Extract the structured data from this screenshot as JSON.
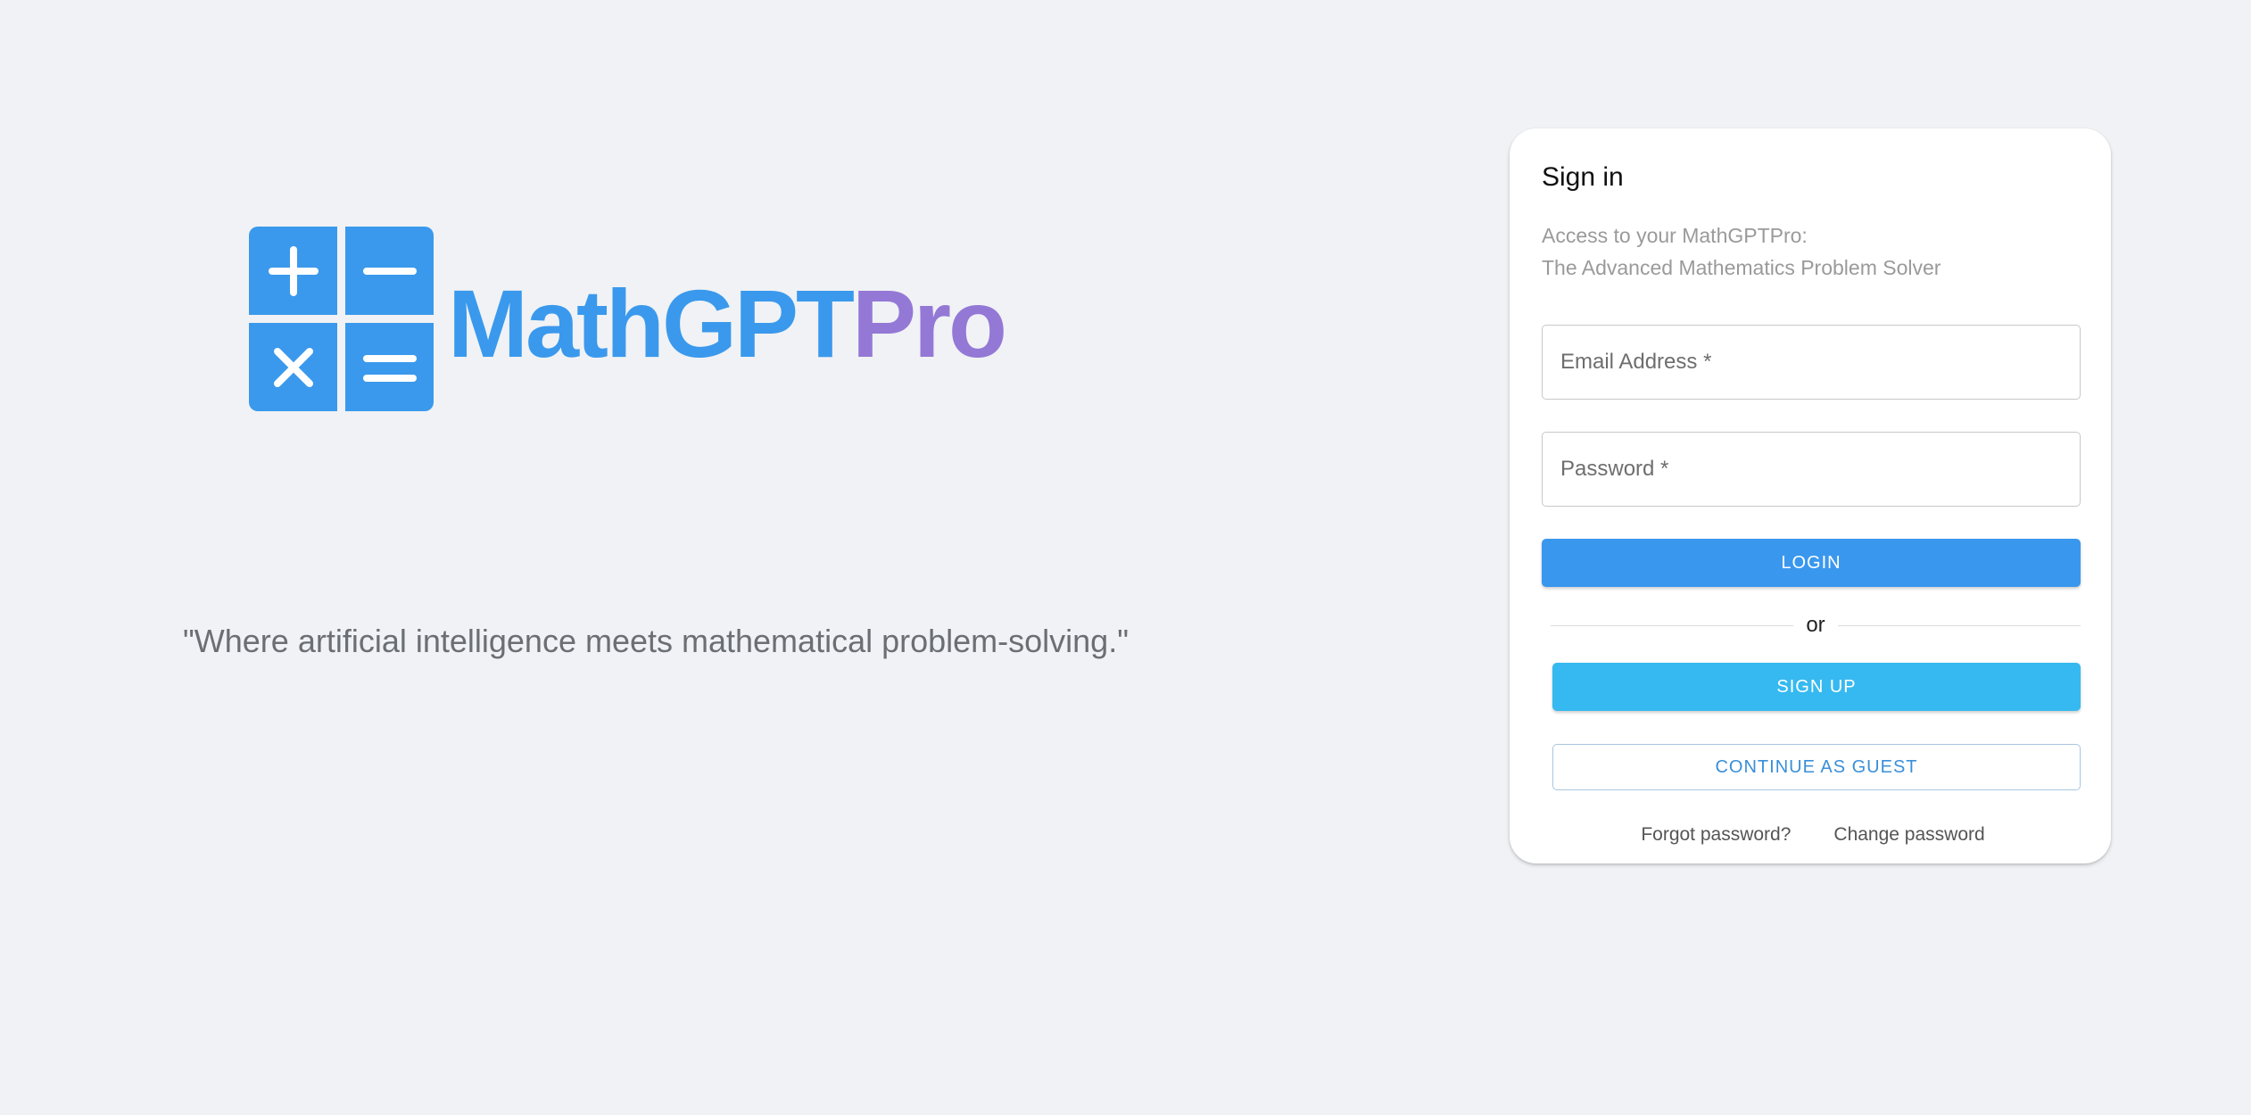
{
  "colors": {
    "background": "#f0f2f5",
    "brand_blue": "#3a99ec",
    "brand_purple": "#9478d6",
    "login_button": "#3a97ee",
    "signup_button": "#36b9f0",
    "guest_text": "#3a8fd8"
  },
  "hero": {
    "logo": {
      "icons": [
        "plus-icon",
        "minus-icon",
        "times-icon",
        "equals-icon"
      ],
      "brand_main": "MathGPT",
      "brand_accent": "Pro"
    },
    "tagline": "\"Where artificial intelligence meets mathematical problem-solving.\""
  },
  "signin": {
    "title": "Sign in",
    "subtitle_line1": "Access to your MathGPTPro:",
    "subtitle_line2": "The Advanced Mathematics Problem Solver",
    "email": {
      "placeholder": "Email Address *",
      "value": ""
    },
    "password": {
      "placeholder": "Password *",
      "value": ""
    },
    "login_label": "LOGIN",
    "divider_text": "or",
    "signup_label": "SIGN UP",
    "guest_label": "CONTINUE AS GUEST",
    "forgot_password": "Forgot password?",
    "change_password": "Change password"
  }
}
